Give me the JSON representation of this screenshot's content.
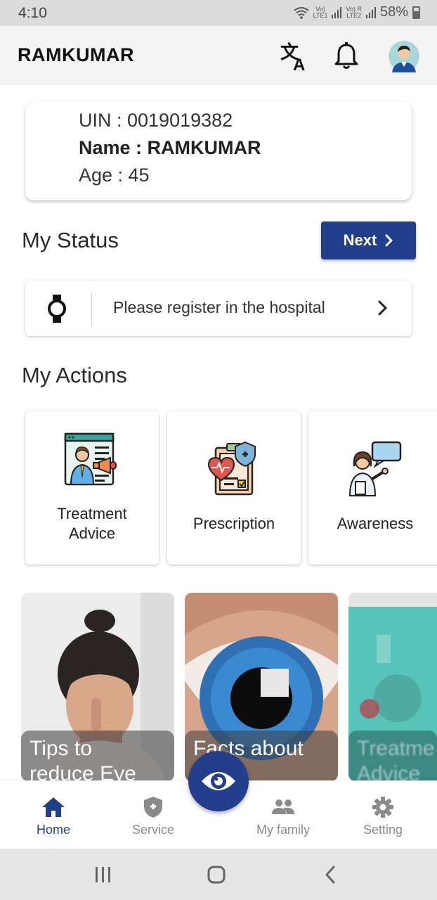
{
  "status_bar": {
    "time": "4:10",
    "sim1_top": "Vo)",
    "sim1_bottom": "LTE1",
    "sim2_top": "Vo) R",
    "sim2_bottom": "LTE2",
    "battery": "58%"
  },
  "app_bar": {
    "title": "RAMKUMAR",
    "icons": [
      "translate-icon",
      "bell-icon",
      "avatar"
    ]
  },
  "patient": {
    "uin": "UIN : 0019019382",
    "name": "Name : RAMKUMAR",
    "age": "Age : 45"
  },
  "status_section": {
    "title": "My Status",
    "next_label": "Next",
    "message": "Please register in the hospital",
    "icon": "watch-icon"
  },
  "actions_section": {
    "title": "My Actions",
    "items": [
      {
        "line1": "Treatment",
        "line2": "Advice",
        "icon": "treatment-advice-icon"
      },
      {
        "line1": "Prescription",
        "icon": "prescription-icon"
      },
      {
        "line1": "Awareness",
        "icon": "awareness-icon"
      }
    ]
  },
  "tips": [
    {
      "line1": "Tips to",
      "line2": "reduce Eye"
    },
    {
      "line1": "Facts about"
    },
    {
      "line1": "Treatme",
      "line2": "Advice"
    }
  ],
  "bottom_nav": {
    "items": [
      {
        "label": "Home",
        "icon": "home-icon",
        "active": true
      },
      {
        "label": "Service",
        "icon": "shield-icon"
      },
      {
        "label": "My family",
        "icon": "family-icon"
      },
      {
        "label": "Setting",
        "icon": "gear-icon"
      }
    ],
    "fab_icon": "eye-icon"
  },
  "colors": {
    "primary": "#233f8b",
    "inactive": "#8a8a8a"
  }
}
